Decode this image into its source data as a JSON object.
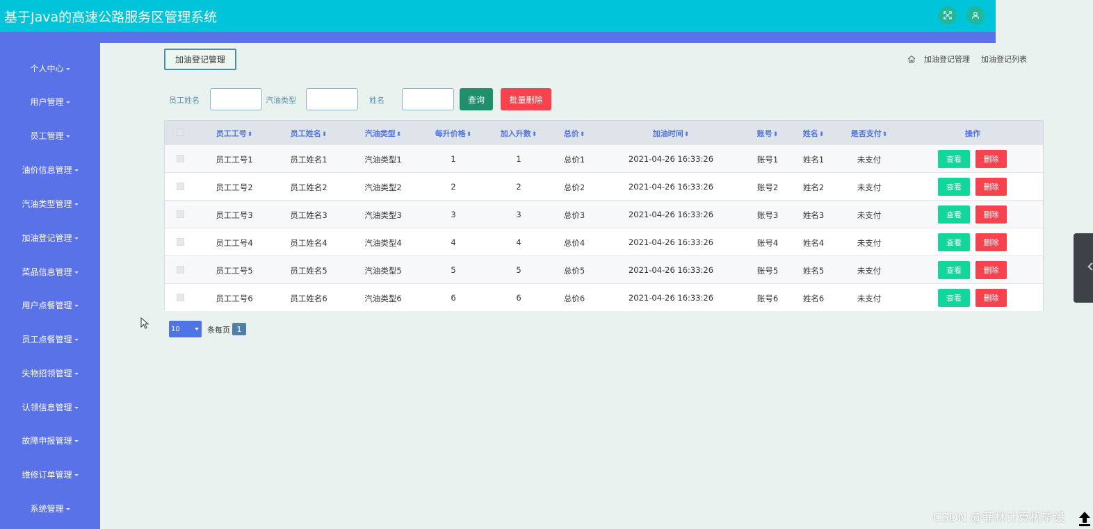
{
  "app": {
    "title": "基于Java的高速公路服务区管理系统"
  },
  "topbar": {
    "icons": [
      "fullscreen-icon",
      "user-icon"
    ]
  },
  "sidebar": {
    "items": [
      {
        "label": "个人中心"
      },
      {
        "label": "用户管理"
      },
      {
        "label": "员工管理"
      },
      {
        "label": "油价信息管理"
      },
      {
        "label": "汽油类型管理"
      },
      {
        "label": "加油登记管理"
      },
      {
        "label": "菜品信息管理"
      },
      {
        "label": "用户点餐管理"
      },
      {
        "label": "员工点餐管理"
      },
      {
        "label": "失物招领管理"
      },
      {
        "label": "认领信息管理"
      },
      {
        "label": "故障申报管理"
      },
      {
        "label": "维修订单管理"
      },
      {
        "label": "系统管理"
      }
    ]
  },
  "page_tag": "加油登记管理",
  "breadcrumb": {
    "items": [
      "加油登记管理",
      "加油登记列表"
    ]
  },
  "search": {
    "fields": [
      {
        "label": "员工姓名",
        "value": "",
        "placeholder": ""
      },
      {
        "label": "汽油类型",
        "value": "",
        "placeholder": ""
      },
      {
        "label": "姓名",
        "value": "",
        "placeholder": ""
      }
    ],
    "query_label": "查询",
    "batch_delete_label": "批量删除"
  },
  "table": {
    "columns": [
      "员工工号",
      "员工姓名",
      "汽油类型",
      "每升价格",
      "加入升数",
      "总价",
      "加油时间",
      "账号",
      "姓名",
      "是否支付",
      "操作"
    ],
    "rows": [
      [
        "员工工号1",
        "员工姓名1",
        "汽油类型1",
        "1",
        "1",
        "总价1",
        "2021-04-26 16:33:26",
        "账号1",
        "姓名1",
        "未支付"
      ],
      [
        "员工工号2",
        "员工姓名2",
        "汽油类型2",
        "2",
        "2",
        "总价2",
        "2021-04-26 16:33:26",
        "账号2",
        "姓名2",
        "未支付"
      ],
      [
        "员工工号3",
        "员工姓名3",
        "汽油类型3",
        "3",
        "3",
        "总价3",
        "2021-04-26 16:33:26",
        "账号3",
        "姓名3",
        "未支付"
      ],
      [
        "员工工号4",
        "员工姓名4",
        "汽油类型4",
        "4",
        "4",
        "总价4",
        "2021-04-26 16:33:26",
        "账号4",
        "姓名4",
        "未支付"
      ],
      [
        "员工工号5",
        "员工姓名5",
        "汽油类型5",
        "5",
        "5",
        "总价5",
        "2021-04-26 16:33:26",
        "账号5",
        "姓名5",
        "未支付"
      ],
      [
        "员工工号6",
        "员工姓名6",
        "汽油类型6",
        "6",
        "6",
        "总价6",
        "2021-04-26 16:33:26",
        "账号6",
        "姓名6",
        "未支付"
      ]
    ],
    "view_label": "查看",
    "delete_label": "删除"
  },
  "pagination": {
    "page_size": "10",
    "page_size_label": "条每页",
    "current_page": "1"
  },
  "watermark": "CSDN @菲林计算机毕设",
  "colors": {
    "topbar": "#00c5da",
    "sidebar": "#5a72e8",
    "accent": "#4f74e5",
    "danger": "#f8424e",
    "success": "#13d69a"
  }
}
